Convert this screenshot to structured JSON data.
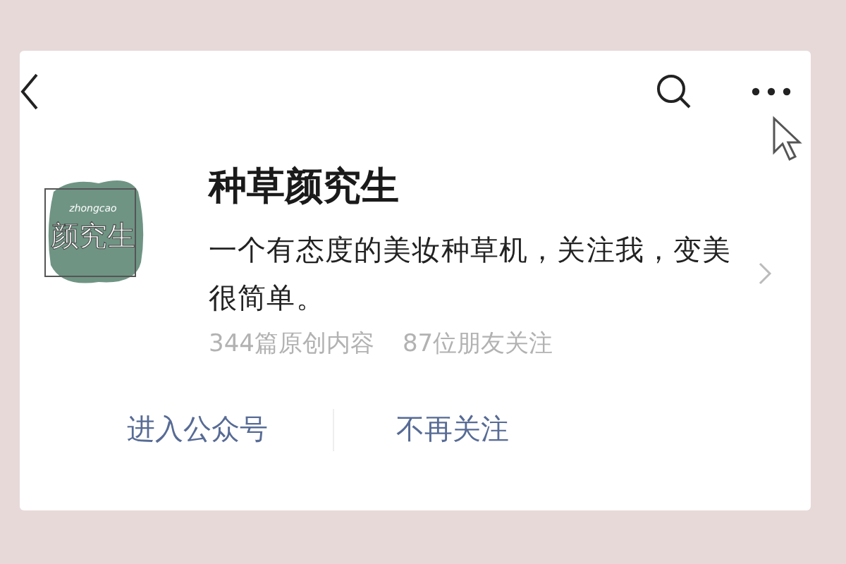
{
  "account": {
    "name": "种草颜究生",
    "logo": {
      "caption": "zhongcao",
      "text": "颜究生"
    },
    "description": "一个有态度的美妆种草机，关注我，变美很简单。",
    "stats": [
      "344篇原创内容",
      "87位朋友关注"
    ]
  },
  "actions": [
    {
      "label": "进入公众号"
    },
    {
      "label": "不再关注"
    }
  ]
}
